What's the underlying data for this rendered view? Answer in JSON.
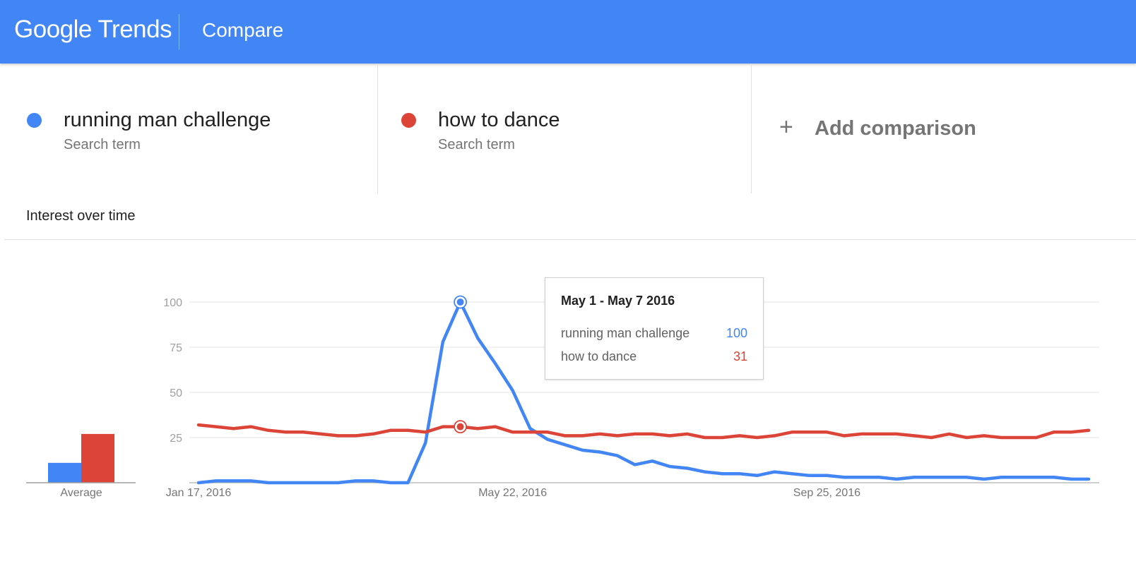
{
  "header": {
    "logo_google": "Google",
    "logo_trends": "Trends",
    "page_title": "Compare"
  },
  "terms": [
    {
      "name": "running man challenge",
      "type": "Search term",
      "color": "#4285f4"
    },
    {
      "name": "how to dance",
      "type": "Search term",
      "color": "#db4437"
    }
  ],
  "add_comparison": {
    "icon": "plus-icon",
    "label": "Add comparison"
  },
  "section_title": "Interest over time",
  "tooltip": {
    "title": "May 1 - May 7 2016",
    "rows": [
      {
        "label": "running man challenge",
        "value": "100",
        "color": "#4285f4"
      },
      {
        "label": "how to dance",
        "value": "31",
        "color": "#db4437"
      }
    ]
  },
  "chart_data": {
    "type": "line",
    "title": "Interest over time",
    "x_tick_labels": [
      "Jan 17, 2016",
      "May 22, 2016",
      "Sep 25, 2016"
    ],
    "x_tick_indices": [
      0,
      18,
      36
    ],
    "ylim": [
      0,
      100
    ],
    "y_ticks": [
      100,
      75,
      50,
      25
    ],
    "grid": true,
    "highlight_index": 15,
    "series": [
      {
        "name": "running man challenge",
        "color": "#4285f4",
        "values": [
          0,
          1,
          1,
          1,
          0,
          0,
          0,
          0,
          0,
          1,
          1,
          0,
          0,
          22,
          78,
          100,
          80,
          66,
          51,
          30,
          24,
          21,
          18,
          17,
          15,
          10,
          12,
          9,
          8,
          6,
          5,
          5,
          4,
          6,
          5,
          4,
          4,
          3,
          3,
          3,
          2,
          3,
          3,
          3,
          3,
          2,
          3,
          3,
          3,
          3,
          2,
          2
        ]
      },
      {
        "name": "how to dance",
        "color": "#db4437",
        "values": [
          32,
          31,
          30,
          31,
          29,
          28,
          28,
          27,
          26,
          26,
          27,
          29,
          29,
          28,
          31,
          31,
          30,
          31,
          28,
          28,
          28,
          26,
          26,
          27,
          26,
          27,
          27,
          26,
          27,
          25,
          25,
          26,
          25,
          26,
          28,
          28,
          28,
          26,
          27,
          27,
          27,
          26,
          25,
          27,
          25,
          26,
          25,
          25,
          25,
          28,
          28,
          29
        ]
      }
    ],
    "average": {
      "label": "Average",
      "values": [
        {
          "name": "running man challenge",
          "value": 11,
          "color": "#4285f4"
        },
        {
          "name": "how to dance",
          "value": 27,
          "color": "#db4437"
        }
      ]
    }
  }
}
